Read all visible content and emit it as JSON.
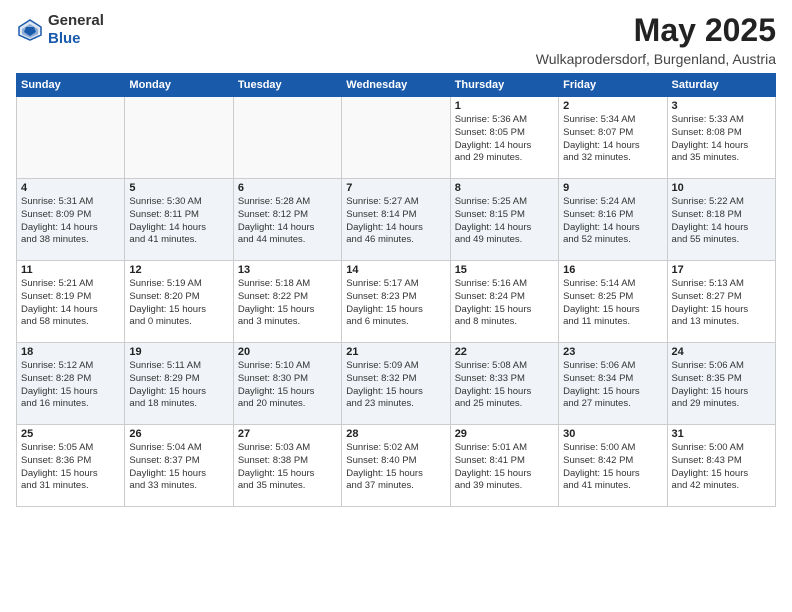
{
  "header": {
    "logo_general": "General",
    "logo_blue": "Blue",
    "title": "May 2025",
    "subtitle": "Wulkaprodersdorf, Burgenland, Austria"
  },
  "weekdays": [
    "Sunday",
    "Monday",
    "Tuesday",
    "Wednesday",
    "Thursday",
    "Friday",
    "Saturday"
  ],
  "weeks": [
    [
      {
        "day": "",
        "info": ""
      },
      {
        "day": "",
        "info": ""
      },
      {
        "day": "",
        "info": ""
      },
      {
        "day": "",
        "info": ""
      },
      {
        "day": "1",
        "info": "Sunrise: 5:36 AM\nSunset: 8:05 PM\nDaylight: 14 hours\nand 29 minutes."
      },
      {
        "day": "2",
        "info": "Sunrise: 5:34 AM\nSunset: 8:07 PM\nDaylight: 14 hours\nand 32 minutes."
      },
      {
        "day": "3",
        "info": "Sunrise: 5:33 AM\nSunset: 8:08 PM\nDaylight: 14 hours\nand 35 minutes."
      }
    ],
    [
      {
        "day": "4",
        "info": "Sunrise: 5:31 AM\nSunset: 8:09 PM\nDaylight: 14 hours\nand 38 minutes."
      },
      {
        "day": "5",
        "info": "Sunrise: 5:30 AM\nSunset: 8:11 PM\nDaylight: 14 hours\nand 41 minutes."
      },
      {
        "day": "6",
        "info": "Sunrise: 5:28 AM\nSunset: 8:12 PM\nDaylight: 14 hours\nand 44 minutes."
      },
      {
        "day": "7",
        "info": "Sunrise: 5:27 AM\nSunset: 8:14 PM\nDaylight: 14 hours\nand 46 minutes."
      },
      {
        "day": "8",
        "info": "Sunrise: 5:25 AM\nSunset: 8:15 PM\nDaylight: 14 hours\nand 49 minutes."
      },
      {
        "day": "9",
        "info": "Sunrise: 5:24 AM\nSunset: 8:16 PM\nDaylight: 14 hours\nand 52 minutes."
      },
      {
        "day": "10",
        "info": "Sunrise: 5:22 AM\nSunset: 8:18 PM\nDaylight: 14 hours\nand 55 minutes."
      }
    ],
    [
      {
        "day": "11",
        "info": "Sunrise: 5:21 AM\nSunset: 8:19 PM\nDaylight: 14 hours\nand 58 minutes."
      },
      {
        "day": "12",
        "info": "Sunrise: 5:19 AM\nSunset: 8:20 PM\nDaylight: 15 hours\nand 0 minutes."
      },
      {
        "day": "13",
        "info": "Sunrise: 5:18 AM\nSunset: 8:22 PM\nDaylight: 15 hours\nand 3 minutes."
      },
      {
        "day": "14",
        "info": "Sunrise: 5:17 AM\nSunset: 8:23 PM\nDaylight: 15 hours\nand 6 minutes."
      },
      {
        "day": "15",
        "info": "Sunrise: 5:16 AM\nSunset: 8:24 PM\nDaylight: 15 hours\nand 8 minutes."
      },
      {
        "day": "16",
        "info": "Sunrise: 5:14 AM\nSunset: 8:25 PM\nDaylight: 15 hours\nand 11 minutes."
      },
      {
        "day": "17",
        "info": "Sunrise: 5:13 AM\nSunset: 8:27 PM\nDaylight: 15 hours\nand 13 minutes."
      }
    ],
    [
      {
        "day": "18",
        "info": "Sunrise: 5:12 AM\nSunset: 8:28 PM\nDaylight: 15 hours\nand 16 minutes."
      },
      {
        "day": "19",
        "info": "Sunrise: 5:11 AM\nSunset: 8:29 PM\nDaylight: 15 hours\nand 18 minutes."
      },
      {
        "day": "20",
        "info": "Sunrise: 5:10 AM\nSunset: 8:30 PM\nDaylight: 15 hours\nand 20 minutes."
      },
      {
        "day": "21",
        "info": "Sunrise: 5:09 AM\nSunset: 8:32 PM\nDaylight: 15 hours\nand 23 minutes."
      },
      {
        "day": "22",
        "info": "Sunrise: 5:08 AM\nSunset: 8:33 PM\nDaylight: 15 hours\nand 25 minutes."
      },
      {
        "day": "23",
        "info": "Sunrise: 5:06 AM\nSunset: 8:34 PM\nDaylight: 15 hours\nand 27 minutes."
      },
      {
        "day": "24",
        "info": "Sunrise: 5:06 AM\nSunset: 8:35 PM\nDaylight: 15 hours\nand 29 minutes."
      }
    ],
    [
      {
        "day": "25",
        "info": "Sunrise: 5:05 AM\nSunset: 8:36 PM\nDaylight: 15 hours\nand 31 minutes."
      },
      {
        "day": "26",
        "info": "Sunrise: 5:04 AM\nSunset: 8:37 PM\nDaylight: 15 hours\nand 33 minutes."
      },
      {
        "day": "27",
        "info": "Sunrise: 5:03 AM\nSunset: 8:38 PM\nDaylight: 15 hours\nand 35 minutes."
      },
      {
        "day": "28",
        "info": "Sunrise: 5:02 AM\nSunset: 8:40 PM\nDaylight: 15 hours\nand 37 minutes."
      },
      {
        "day": "29",
        "info": "Sunrise: 5:01 AM\nSunset: 8:41 PM\nDaylight: 15 hours\nand 39 minutes."
      },
      {
        "day": "30",
        "info": "Sunrise: 5:00 AM\nSunset: 8:42 PM\nDaylight: 15 hours\nand 41 minutes."
      },
      {
        "day": "31",
        "info": "Sunrise: 5:00 AM\nSunset: 8:43 PM\nDaylight: 15 hours\nand 42 minutes."
      }
    ]
  ]
}
